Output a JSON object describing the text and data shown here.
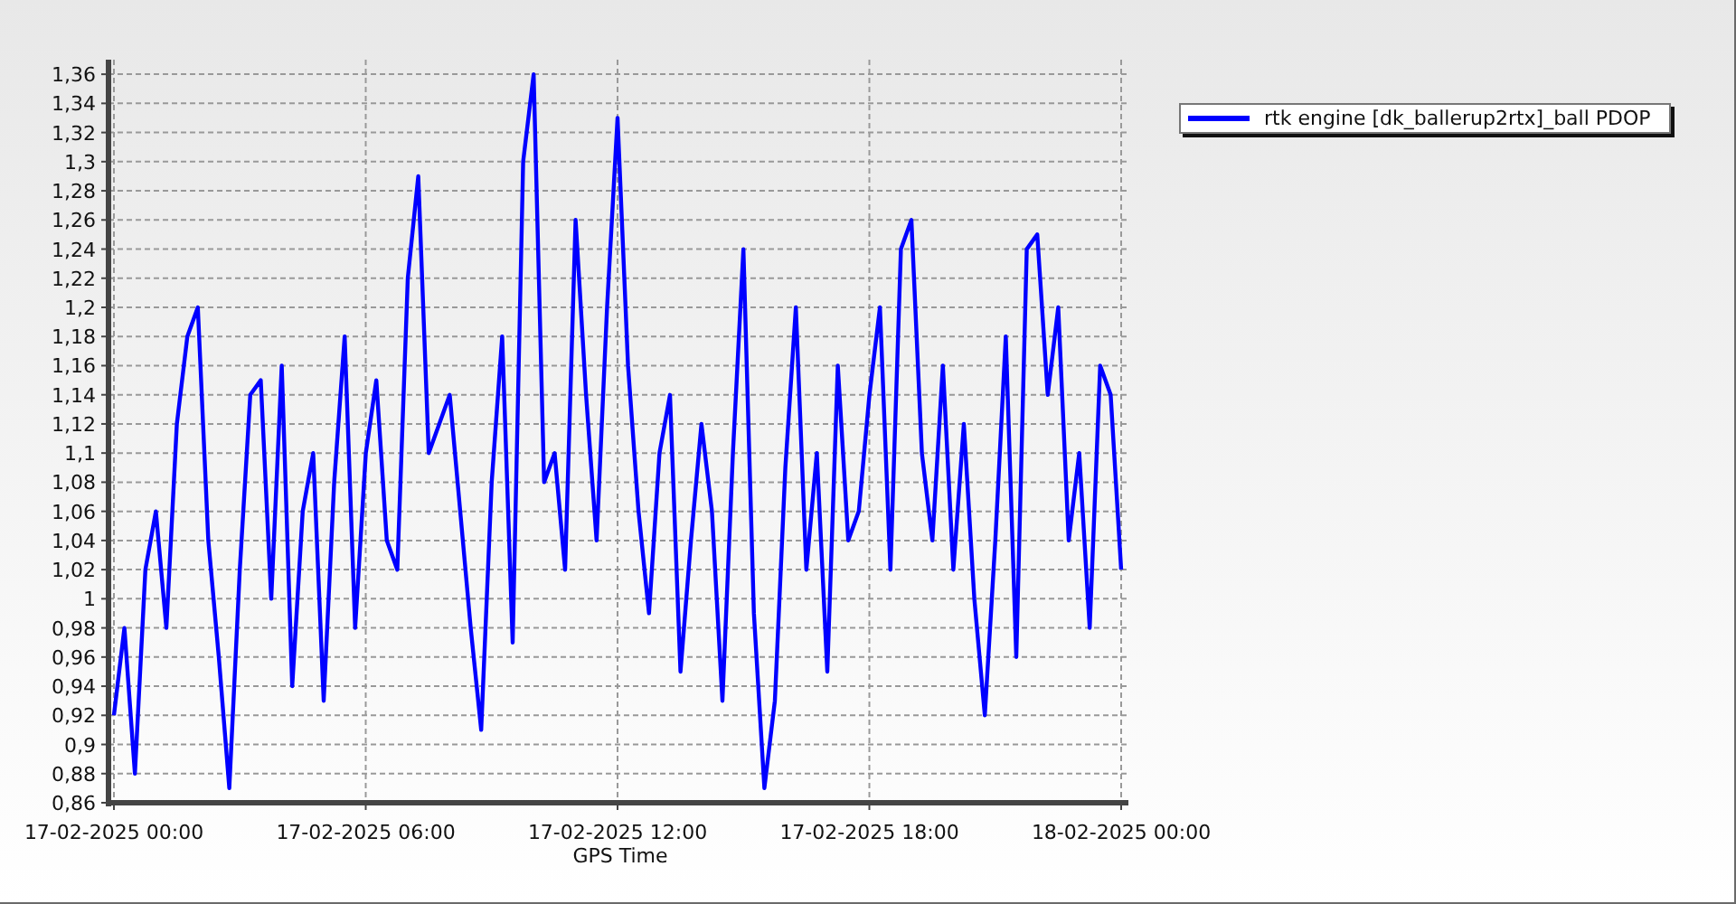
{
  "chart": {
    "chart_data": {
      "type": "line",
      "grid": true,
      "xlabel": "GPS Time",
      "ylim": [
        0.86,
        1.37
      ],
      "categories": [
        "17-02-2025 00:00",
        null,
        null,
        null,
        null,
        null,
        null,
        null,
        null,
        null,
        null,
        null,
        null,
        null,
        null,
        null,
        null,
        null,
        null,
        null,
        null,
        null,
        null,
        null,
        "17-02-2025 06:00",
        null,
        null,
        null,
        null,
        null,
        null,
        null,
        null,
        null,
        null,
        null,
        null,
        null,
        null,
        null,
        null,
        null,
        null,
        null,
        null,
        null,
        null,
        null,
        "17-02-2025 12:00",
        null,
        null,
        null,
        null,
        null,
        null,
        null,
        null,
        null,
        null,
        null,
        null,
        null,
        null,
        null,
        null,
        null,
        null,
        null,
        null,
        null,
        null,
        null,
        "17-02-2025 18:00",
        null,
        null,
        null,
        null,
        null,
        null,
        null,
        null,
        null,
        null,
        null,
        null,
        null,
        null,
        null,
        null,
        null,
        null,
        null,
        null,
        null,
        null,
        null,
        "18-02-2025 00:00"
      ],
      "yticks": [
        {
          "value": 0.86,
          "label": "0,86"
        },
        {
          "value": 0.88,
          "label": "0,88"
        },
        {
          "value": 0.9,
          "label": "0,9"
        },
        {
          "value": 0.92,
          "label": "0,92"
        },
        {
          "value": 0.94,
          "label": "0,94"
        },
        {
          "value": 0.96,
          "label": "0,96"
        },
        {
          "value": 0.98,
          "label": "0,98"
        },
        {
          "value": 1,
          "label": "1"
        },
        {
          "value": 1.02,
          "label": "1,02"
        },
        {
          "value": 1.04,
          "label": "1,04"
        },
        {
          "value": 1.06,
          "label": "1,06"
        },
        {
          "value": 1.08,
          "label": "1,08"
        },
        {
          "value": 1.1,
          "label": "1,1"
        },
        {
          "value": 1.12,
          "label": "1,12"
        },
        {
          "value": 1.14,
          "label": "1,14"
        },
        {
          "value": 1.16,
          "label": "1,16"
        },
        {
          "value": 1.18,
          "label": "1,18"
        },
        {
          "value": 1.2,
          "label": "1,2"
        },
        {
          "value": 1.22,
          "label": "1,22"
        },
        {
          "value": 1.24,
          "label": "1,24"
        },
        {
          "value": 1.26,
          "label": "1,26"
        },
        {
          "value": 1.28,
          "label": "1,28"
        },
        {
          "value": 1.3,
          "label": "1,3"
        },
        {
          "value": 1.32,
          "label": "1,32"
        },
        {
          "value": 1.34,
          "label": "1,34"
        },
        {
          "value": 1.36,
          "label": "1,36"
        }
      ],
      "series": [
        {
          "name": "rtk engine [dk_ballerup2rtx]_ball PDOP",
          "color": "#0000ff",
          "values": [
            0.92,
            0.98,
            0.88,
            1.02,
            1.06,
            0.98,
            1.12,
            1.18,
            1.2,
            1.04,
            0.96,
            0.87,
            1.02,
            1.14,
            1.15,
            1.0,
            1.16,
            0.94,
            1.06,
            1.1,
            0.93,
            1.08,
            1.18,
            0.98,
            1.1,
            1.15,
            1.04,
            1.02,
            1.22,
            1.29,
            1.1,
            1.12,
            1.14,
            1.06,
            0.98,
            0.91,
            1.08,
            1.18,
            0.97,
            1.3,
            1.36,
            1.08,
            1.1,
            1.02,
            1.26,
            1.14,
            1.04,
            1.2,
            1.33,
            1.16,
            1.06,
            0.99,
            1.1,
            1.14,
            0.95,
            1.04,
            1.12,
            1.06,
            0.93,
            1.1,
            1.24,
            0.99,
            0.87,
            0.93,
            1.09,
            1.2,
            1.02,
            1.1,
            0.95,
            1.16,
            1.04,
            1.06,
            1.14,
            1.2,
            1.02,
            1.24,
            1.26,
            1.1,
            1.04,
            1.16,
            1.02,
            1.12,
            1.0,
            0.92,
            1.04,
            1.18,
            0.96,
            1.24,
            1.25,
            1.14,
            1.2,
            1.04,
            1.1,
            0.98,
            1.16,
            1.14,
            1.02
          ]
        }
      ]
    }
  }
}
